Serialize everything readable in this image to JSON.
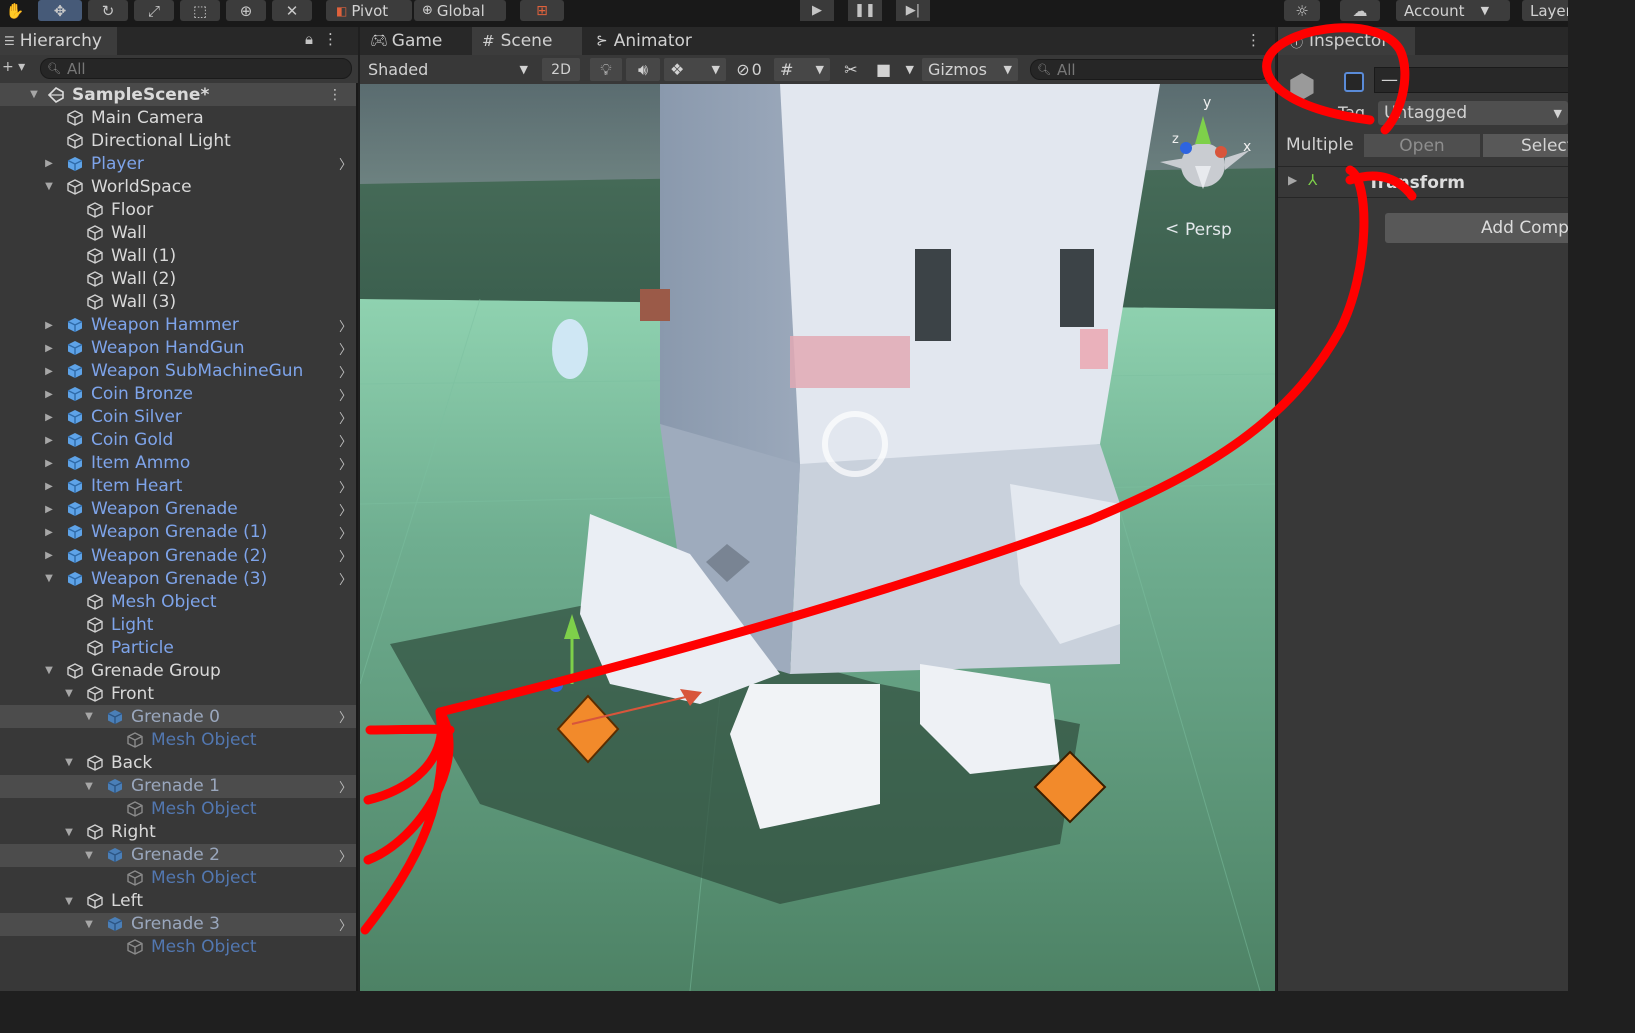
{
  "topbar": {
    "pivot_label": "Pivot",
    "global_label": "Global",
    "account_label": "Account",
    "layers_label": "Layers",
    "icons": [
      "hand-tool-icon",
      "move-tool-icon",
      "rotate-tool-icon",
      "scale-tool-icon",
      "rect-tool-icon",
      "transform-tool-icon",
      "custom-tool-icon",
      "snap-icon",
      "play-icon",
      "pause-icon",
      "step-icon",
      "sun-icon",
      "cloud-icon"
    ]
  },
  "hierarchy": {
    "tab_label": "Hierarchy",
    "search_placeholder": "All",
    "scene_name": "SampleScene*",
    "items": [
      {
        "label": "Main Camera",
        "level": 1,
        "kind": "go"
      },
      {
        "label": "Directional Light",
        "level": 1,
        "kind": "go"
      },
      {
        "label": "Player",
        "level": 1,
        "kind": "prefab",
        "collapsed": true
      },
      {
        "label": "WorldSpace",
        "level": 1,
        "kind": "go",
        "expanded": true
      },
      {
        "label": "Floor",
        "level": 2,
        "kind": "go"
      },
      {
        "label": "Wall",
        "level": 2,
        "kind": "go"
      },
      {
        "label": "Wall (1)",
        "level": 2,
        "kind": "go"
      },
      {
        "label": "Wall (2)",
        "level": 2,
        "kind": "go"
      },
      {
        "label": "Wall (3)",
        "level": 2,
        "kind": "go"
      },
      {
        "label": "Weapon Hammer",
        "level": 1,
        "kind": "prefab",
        "collapsed": true
      },
      {
        "label": "Weapon HandGun",
        "level": 1,
        "kind": "prefab",
        "collapsed": true
      },
      {
        "label": "Weapon SubMachineGun",
        "level": 1,
        "kind": "prefab",
        "collapsed": true
      },
      {
        "label": "Coin Bronze",
        "level": 1,
        "kind": "prefab",
        "collapsed": true
      },
      {
        "label": "Coin Silver",
        "level": 1,
        "kind": "prefab",
        "collapsed": true
      },
      {
        "label": "Coin Gold",
        "level": 1,
        "kind": "prefab",
        "collapsed": true
      },
      {
        "label": "Item Ammo",
        "level": 1,
        "kind": "prefab",
        "collapsed": true
      },
      {
        "label": "Item Heart",
        "level": 1,
        "kind": "prefab",
        "collapsed": true
      },
      {
        "label": "Weapon Grenade",
        "level": 1,
        "kind": "prefab",
        "collapsed": true
      },
      {
        "label": "Weapon Grenade (1)",
        "level": 1,
        "kind": "prefab",
        "collapsed": true
      },
      {
        "label": "Weapon Grenade (2)",
        "level": 1,
        "kind": "prefab",
        "collapsed": true
      },
      {
        "label": "Weapon Grenade (3)",
        "level": 1,
        "kind": "prefab",
        "expanded": true
      },
      {
        "label": "Mesh Object",
        "level": 2,
        "kind": "prefab-child"
      },
      {
        "label": "Light",
        "level": 2,
        "kind": "prefab-child"
      },
      {
        "label": "Particle",
        "level": 2,
        "kind": "prefab-child"
      },
      {
        "label": "Grenade Group",
        "level": 1,
        "kind": "go",
        "expanded": true
      },
      {
        "label": "Front",
        "level": 2,
        "kind": "go",
        "expanded": true
      },
      {
        "label": "Grenade 0",
        "level": 3,
        "kind": "prefab-dim",
        "expanded": true,
        "selected": true
      },
      {
        "label": "Mesh Object",
        "level": 4,
        "kind": "prefab-dim-child"
      },
      {
        "label": "Back",
        "level": 2,
        "kind": "go",
        "expanded": true
      },
      {
        "label": "Grenade 1",
        "level": 3,
        "kind": "prefab-dim",
        "expanded": true,
        "selected": true
      },
      {
        "label": "Mesh Object",
        "level": 4,
        "kind": "prefab-dim-child"
      },
      {
        "label": "Right",
        "level": 2,
        "kind": "go",
        "expanded": true
      },
      {
        "label": "Grenade 2",
        "level": 3,
        "kind": "prefab-dim",
        "expanded": true,
        "selected": true
      },
      {
        "label": "Mesh Object",
        "level": 4,
        "kind": "prefab-dim-child"
      },
      {
        "label": "Left",
        "level": 2,
        "kind": "go",
        "expanded": true
      },
      {
        "label": "Grenade 3",
        "level": 3,
        "kind": "prefab-dim",
        "expanded": true,
        "selected": true
      },
      {
        "label": "Mesh Object",
        "level": 4,
        "kind": "prefab-dim-child"
      }
    ]
  },
  "scene": {
    "tabs": [
      {
        "label": "Game",
        "icon": "gamepad-icon"
      },
      {
        "label": "Scene",
        "icon": "grid-hash-icon",
        "active": true
      },
      {
        "label": "Animator",
        "icon": "animator-icon"
      }
    ],
    "shading_mode": "Shaded",
    "toggle_2d": "2D",
    "hidden_count": "0",
    "gizmos_label": "Gizmos",
    "search_placeholder": "All",
    "persp_label": "Persp",
    "gizmo_axes": {
      "y": "y",
      "x": "x",
      "z": "z"
    }
  },
  "inspector": {
    "tab_label": "Inspector",
    "tag_label": "Tag",
    "tag_value": "Untagged",
    "multiple_label": "Multiple",
    "open_label": "Open",
    "select_label": "Select",
    "component_name": "Transform",
    "add_component_label": "Add Component"
  },
  "colors": {
    "annotation": "#ff0000",
    "prefab_blue": "#7ea4ea",
    "selected_prefab": "#5277b0"
  }
}
